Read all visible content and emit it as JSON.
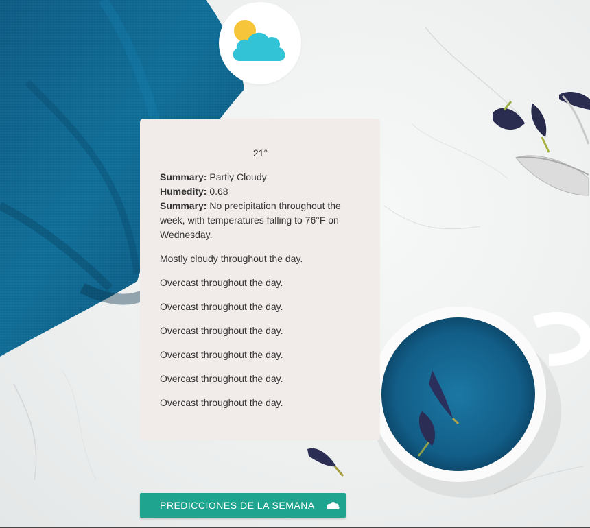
{
  "weather": {
    "temperature": "21°",
    "summary_label": "Summary:",
    "summary_value": " Partly Cloudy",
    "humidity_label": "Humedity:",
    "humidity_value": " 0.68",
    "week_label": "Summary:",
    "week_value": " No precipitation throughout the week, with temperatures falling to 76°F on Wednesday."
  },
  "daily": [
    "Mostly cloudy throughout the day.",
    "Overcast throughout the day.",
    "Overcast throughout the day.",
    "Overcast throughout the day.",
    "Overcast throughout the day.",
    "Overcast throughout the day.",
    "Overcast throughout the day."
  ],
  "button": {
    "label": "PREDICCIONES DE LA SEMANA",
    "icon": "cloud-icon"
  },
  "logo": {
    "icon": "partly-cloudy-icon",
    "sun_color": "#f7c53a",
    "cloud_color": "#32c3d6"
  },
  "colors": {
    "card_bg": "#f1ebe9",
    "button_bg": "#1fa58f",
    "button_text": "#ffffff"
  }
}
